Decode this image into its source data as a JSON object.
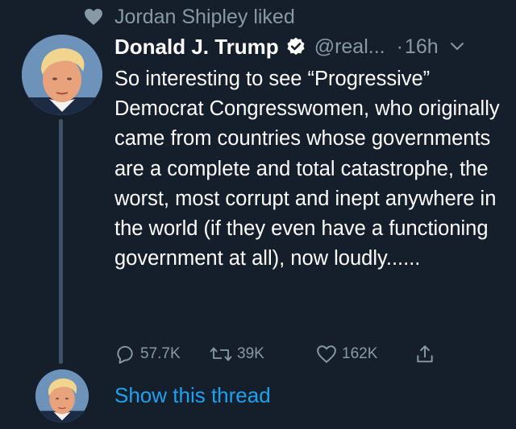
{
  "social_context": {
    "icon": "heart-icon",
    "text": "Jordan Shipley liked"
  },
  "tweet": {
    "author_name": "Donald J. Trump",
    "verified_icon": "verified-badge-icon",
    "handle": "@real...",
    "separator": "·",
    "time": "16h",
    "menu_icon": "chevron-down-icon",
    "text": "So interesting to see “Progressive” Democrat Congresswomen, who originally came from countries whose governments are a complete and total catastrophe, the worst, most corrupt and inept anywhere in the world (if they even have a functioning government at all), now loudly......",
    "actions": {
      "reply_count": "57.7K",
      "retweet_count": "39K",
      "like_count": "162K"
    }
  },
  "thread": {
    "show_thread_label": "Show this thread"
  },
  "colors": {
    "background": "#151f2b",
    "text_primary": "#ffffff",
    "text_secondary": "#8899a6",
    "link": "#1da1f2",
    "verified": "#ffffff",
    "thread_line": "#3d5466"
  }
}
